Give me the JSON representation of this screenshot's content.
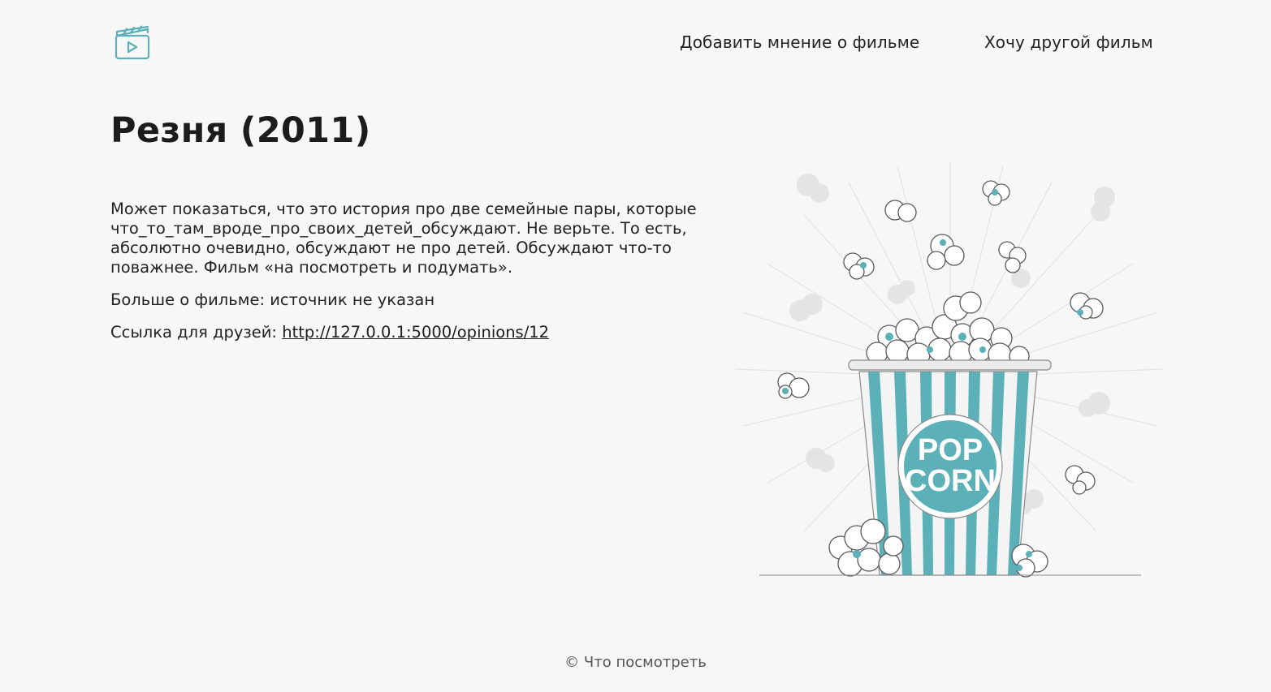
{
  "header": {
    "logo_icon": "film-clapper-play-icon",
    "nav": {
      "add_opinion": "Добавить мнение о фильме",
      "other_film": "Хочу другой фильм"
    }
  },
  "main": {
    "title": "Резня (2011)",
    "description": "Может показаться, что это история про две семейные пары, которые что_то_там_вроде_про_своих_детей_обсуждают. Не верьте. То есть, абсолютно очевидно, обсуждают не про детей. Обсуждают что-то поважнее. Фильм «на посмотреть и подумать».",
    "source_label": "Больше о фильме: ",
    "source_value": "источник не указан",
    "share_label": "Ссылка для друзей: ",
    "share_url": "http://127.0.0.1:5000/opinions/12"
  },
  "illustration": {
    "icon": "popcorn-bucket-illustration",
    "bucket_text_line1": "POP",
    "bucket_text_line2": "CORN"
  },
  "footer": {
    "copyright": "© Что посмотреть"
  },
  "colors": {
    "accent": "#5bb1b7",
    "background": "#f7f7f8",
    "text": "#222222"
  }
}
